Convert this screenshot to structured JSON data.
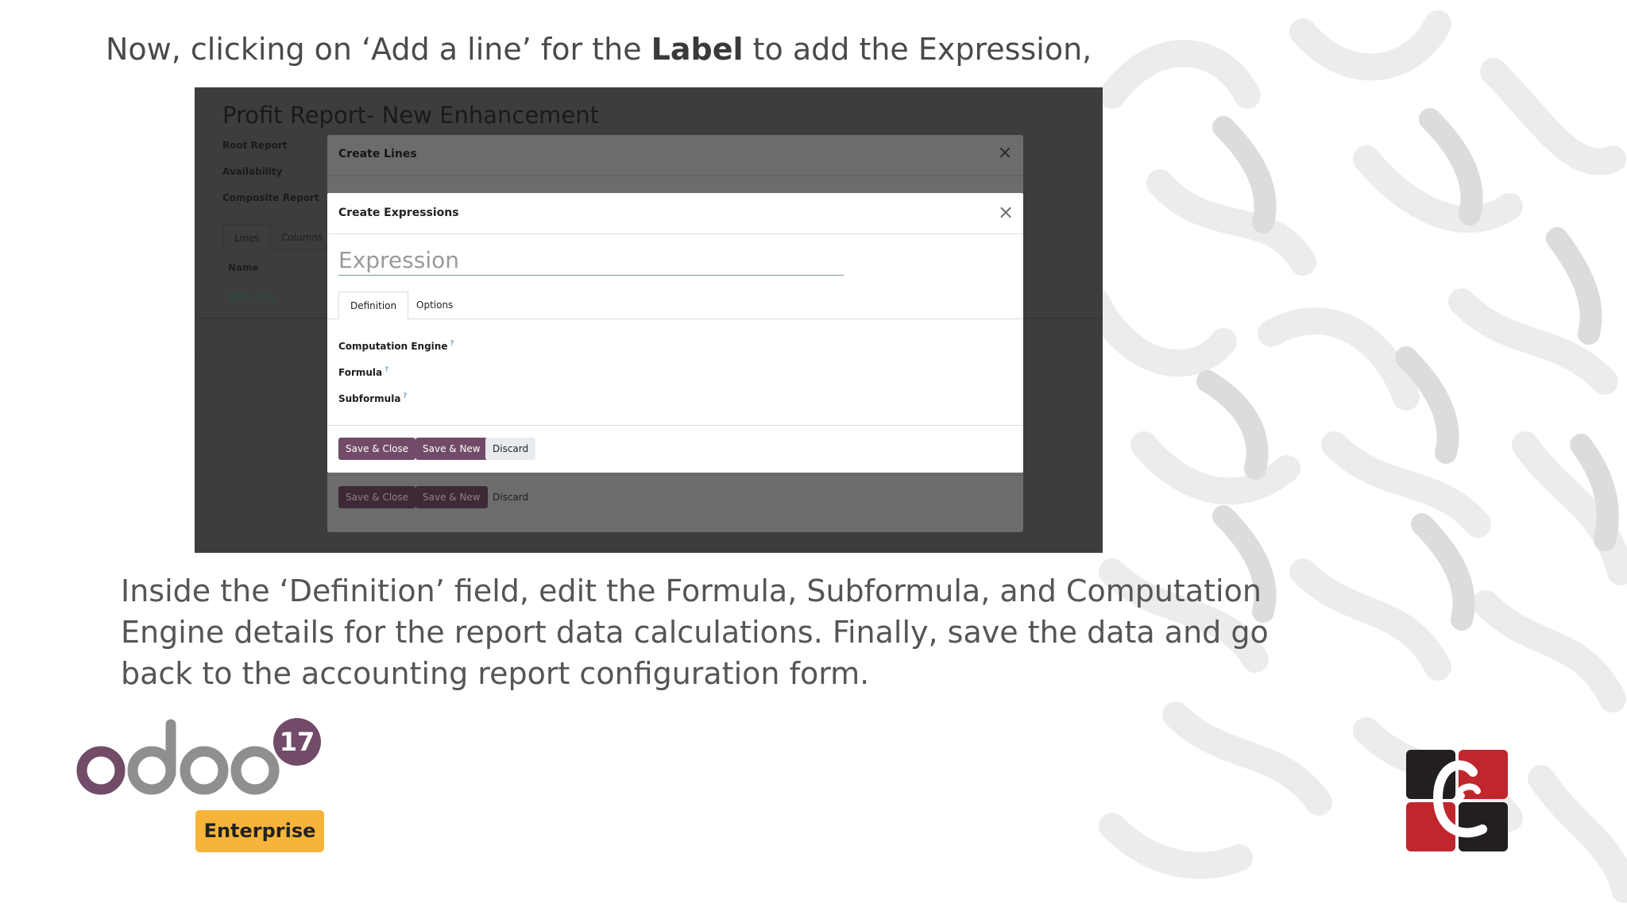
{
  "heading": {
    "before": "Now, clicking on ‘Add a line’ for the ",
    "bold": "Label",
    "after": " to add the Expression,"
  },
  "screenshot": {
    "background": {
      "title": "Profit Report- New Enhancement",
      "fields": [
        "Root Report",
        "Availability",
        "Composite Report"
      ],
      "tabs": [
        "Lines",
        "Columns"
      ],
      "column_name": "Name",
      "add_line": "Add a line"
    },
    "outer_modal": {
      "title": "Create Lines",
      "buttons": {
        "save_close": "Save & Close",
        "save_new": "Save & New",
        "discard": "Discard"
      }
    },
    "inner_modal": {
      "title": "Create Expressions",
      "expression_placeholder": "Expression",
      "tabs": {
        "definition": "Definition",
        "options": "Options"
      },
      "fields": {
        "computation_engine": "Computation Engine",
        "formula": "Formula",
        "subformula": "Subformula"
      },
      "help_mark": "?",
      "buttons": {
        "save_close": "Save & Close",
        "save_new": "Save & New",
        "discard": "Discard"
      }
    }
  },
  "description": "Inside the ‘Definition’ field, edit the Formula, Subformula, and Computation Engine details for the report data calculations. Finally, save the data and go back to the accounting report configuration form.",
  "logos": {
    "odoo": "odoo",
    "version": "17",
    "edition": "Enterprise",
    "brand_icon": "cybrosys-logo-icon"
  },
  "colors": {
    "odoo_purple": "#714b67",
    "odoo_grey": "#8f8f8f",
    "enterprise_orange": "#f6b43a",
    "brand_red": "#c0272d",
    "brand_dark": "#231f20"
  }
}
